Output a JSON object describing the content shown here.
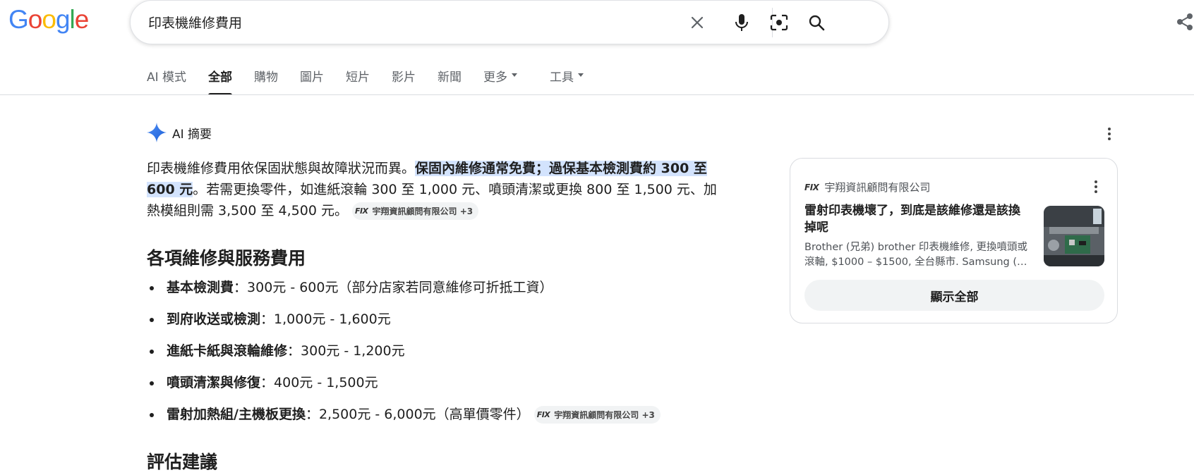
{
  "logo": {
    "letters": [
      "G",
      "o",
      "o",
      "g",
      "l",
      "e"
    ],
    "colors": [
      "#4285F4",
      "#EA4335",
      "#FBBC05",
      "#4285F4",
      "#34A853",
      "#EA4335"
    ]
  },
  "search": {
    "query": "印表機維修費用"
  },
  "tabs": [
    {
      "label": "AI 模式"
    },
    {
      "label": "全部",
      "active": true
    },
    {
      "label": "購物"
    },
    {
      "label": "圖片"
    },
    {
      "label": "短片"
    },
    {
      "label": "影片"
    },
    {
      "label": "新聞"
    },
    {
      "label": "更多",
      "dropdown": true
    },
    {
      "label": "工具",
      "dropdown": true
    }
  ],
  "ai": {
    "header_label": "AI 摘要",
    "summary": {
      "part1": "印表機維修費用依保固狀態與故障狀況而異。",
      "highlight": "保固內維修通常免費；過保基本檢測費約 300 至 600 元",
      "part2": "。若需更換零件，如進紙滾輪 300 至 1,000 元、噴頭清潔或更換 800 至 1,500 元、加熱模組則需 3,500 至 4,500 元。",
      "chip_logo": "FIX",
      "chip_label": "宇翔資訊顧問有限公司 +3"
    },
    "section1_title": "各項維修與服務費用",
    "bullets": [
      {
        "term": "基本檢測費",
        "text": "：300元 - 600元（部分店家若同意維修可折抵工資）"
      },
      {
        "term": "到府收送或檢測",
        "text": "：1,000元 - 1,600元"
      },
      {
        "term": "進紙卡紙與滾輪維修",
        "text": "：300元 - 1,200元"
      },
      {
        "term": "噴頭清潔與修復",
        "text": "：400元 - 1,500元"
      },
      {
        "term": "雷射加熱組/主機板更換",
        "text": "：2,500元 - 6,000元（高單價零件）",
        "chip_logo": "FIX",
        "chip_label": "宇翔資訊顧問有限公司 +3"
      }
    ],
    "section2_title": "評估建議"
  },
  "card": {
    "source_logo": "FIX",
    "source_name": "宇翔資訊顧問有限公司",
    "title": "雷射印表機壞了，到底是該維修還是該換掉呢",
    "snippet": "Brother (兄弟) brother 印表機維修, 更換噴頭或滾軸, $1000 – $1500, 全台縣市. Samsung (…",
    "show_all": "顯示全部"
  }
}
